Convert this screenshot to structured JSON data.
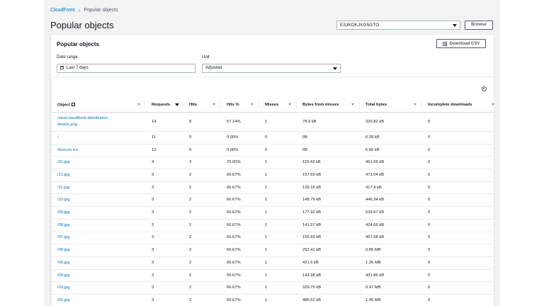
{
  "breadcrumb": {
    "root": "CloudFront",
    "current": "Popular objects"
  },
  "page_title": "Popular objects",
  "distribution": {
    "selected": "E3JKOKJXG5GTO"
  },
  "browse_label": "Browse",
  "panel": {
    "title": "Popular objects",
    "download_csv_label": "Download CSV",
    "date_range": {
      "label": "Date range",
      "value": "Last 7 days"
    },
    "unit": {
      "label": "Unit",
      "value": "Adjusted"
    }
  },
  "table": {
    "headers": [
      "Object",
      "Requests",
      "Hits",
      "Hits %",
      "Misses",
      "Bytes from misses",
      "Total bytes",
      "Incomplete downloads"
    ],
    "rows": [
      {
        "object": "/view-cloudfront-distribution-details.png",
        "object_line1": "/view-cloudfront-distribution-",
        "object_line2": "details.png",
        "requests": "14",
        "hits": "8",
        "hits_pct": "57.14%",
        "misses": "1",
        "bytes_from_misses": "78.9 kB",
        "total_bytes": "320.82 kB",
        "incomplete": "0"
      },
      {
        "object": "/",
        "requests": "11",
        "hits": "0",
        "hits_pct": "0.00%",
        "misses": "0",
        "bytes_from_misses": "0B",
        "total_bytes": "6.28 kB",
        "incomplete": "0"
      },
      {
        "object": "/favicon.ico",
        "requests": "10",
        "hits": "0",
        "hits_pct": "0.00%",
        "misses": "0",
        "bytes_from_misses": "0B",
        "total_bytes": "6.65 kB",
        "incomplete": "0"
      },
      {
        "object": "/01.jpg",
        "requests": "4",
        "hits": "3",
        "hits_pct": "75.00%",
        "misses": "1",
        "bytes_from_misses": "115.43 kB",
        "total_bytes": "461.66 kB",
        "incomplete": "0"
      },
      {
        "object": "/12.jpg",
        "requests": "3",
        "hits": "2",
        "hits_pct": "66.67%",
        "misses": "1",
        "bytes_from_misses": "157.69 kB",
        "total_bytes": "473.04 kB",
        "incomplete": "0"
      },
      {
        "object": "/11.jpg",
        "requests": "3",
        "hits": "2",
        "hits_pct": "66.67%",
        "misses": "1",
        "bytes_from_misses": "139.16 kB",
        "total_bytes": "417.4 kB",
        "incomplete": "0"
      },
      {
        "object": "/10.jpg",
        "requests": "3",
        "hits": "2",
        "hits_pct": "66.67%",
        "misses": "1",
        "bytes_from_misses": "148.79 kB",
        "total_bytes": "446.34 kB",
        "incomplete": "0"
      },
      {
        "object": "/09.jpg",
        "requests": "3",
        "hits": "2",
        "hits_pct": "66.67%",
        "misses": "1",
        "bytes_from_misses": "177.92 kB",
        "total_bytes": "533.67 kB",
        "incomplete": "0"
      },
      {
        "object": "/08.jpg",
        "requests": "3",
        "hits": "2",
        "hits_pct": "66.67%",
        "misses": "1",
        "bytes_from_misses": "141.57 kB",
        "total_bytes": "424.66 kB",
        "incomplete": "0"
      },
      {
        "object": "/07.jpg",
        "requests": "3",
        "hits": "2",
        "hits_pct": "66.67%",
        "misses": "1",
        "bytes_from_misses": "155.93 kB",
        "total_bytes": "467.68 kB",
        "incomplete": "0"
      },
      {
        "object": "/06.jpg",
        "requests": "3",
        "hits": "2",
        "hits_pct": "66.67%",
        "misses": "1",
        "bytes_from_misses": "292.41 kB",
        "total_bytes": "0.86 MB",
        "incomplete": "0"
      },
      {
        "object": "/05.jpg",
        "requests": "3",
        "hits": "2",
        "hits_pct": "66.67%",
        "misses": "1",
        "bytes_from_misses": "431.6 kB",
        "total_bytes": "1.26 MB",
        "incomplete": "0"
      },
      {
        "object": "/04.jpg",
        "requests": "3",
        "hits": "2",
        "hits_pct": "66.67%",
        "misses": "1",
        "bytes_from_misses": "143.98 kB",
        "total_bytes": "431.86 kB",
        "incomplete": "0"
      },
      {
        "object": "/03.jpg",
        "requests": "3",
        "hits": "2",
        "hits_pct": "66.67%",
        "misses": "1",
        "bytes_from_misses": "329.75 kB",
        "total_bytes": "0.97 MB",
        "incomplete": "0"
      },
      {
        "object": "/02.jpg",
        "requests": "3",
        "hits": "2",
        "hits_pct": "66.67%",
        "misses": "1",
        "bytes_from_misses": "486.62 kB",
        "total_bytes": "1.45 MB",
        "incomplete": "0"
      }
    ]
  },
  "icons": {
    "breadcrumb_separator": "chevron-right-icon",
    "select_caret": "caret-down-icon",
    "download": "download-icon",
    "calendar": "calendar-icon",
    "settings": "gear-icon",
    "external_link": "external-link-icon",
    "filter": "filter-icon",
    "sort": "sort-desc-icon"
  }
}
